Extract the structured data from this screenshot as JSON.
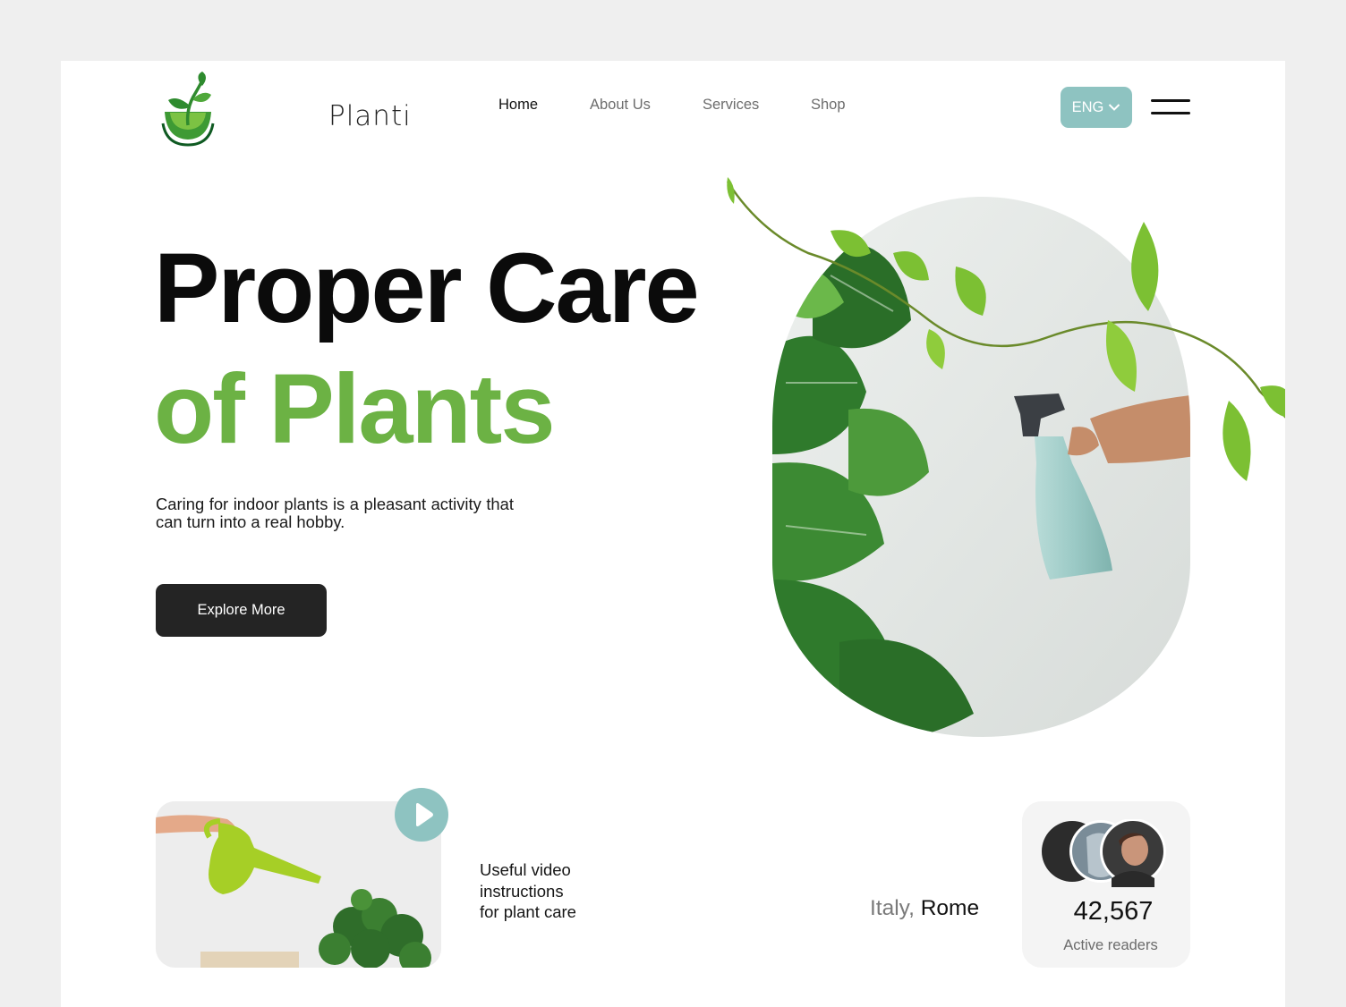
{
  "header": {
    "brand": "Planti",
    "nav": [
      {
        "label": "Home",
        "active": true
      },
      {
        "label": "About Us",
        "active": false
      },
      {
        "label": "Services",
        "active": false
      },
      {
        "label": "Shop",
        "active": false
      }
    ],
    "language": "ENG",
    "icons": {
      "logo": "sprout-bowl-logo",
      "language_chevron": "chevron-down-icon",
      "menu": "menu-icon"
    }
  },
  "hero": {
    "title_line1": "Proper Care",
    "title_line2": "of Plants",
    "description": "Caring for indoor plants is a pleasant activity that can turn into a real hobby.",
    "cta_label": "Explore More"
  },
  "video": {
    "text_lines": [
      "Useful video",
      "instructions",
      "for plant care"
    ],
    "icon": "play-icon"
  },
  "location": {
    "country": "Italy,",
    "city": "Rome"
  },
  "readers": {
    "count": "42,567",
    "label": "Active readers"
  },
  "colors": {
    "page_bg": "#efefef",
    "accent_green": "#6cb244",
    "accent_teal": "#8ec3c1",
    "button_dark": "#242424"
  }
}
